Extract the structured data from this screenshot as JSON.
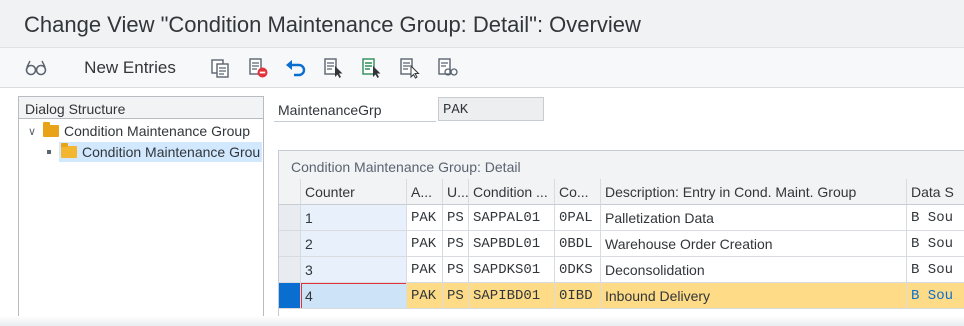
{
  "title": "Change View \"Condition Maintenance Group: Detail\": Overview",
  "toolbar": {
    "new_entries_label": "New Entries",
    "icons": [
      "glasses-icon",
      "copy-icon",
      "delete-icon",
      "undo-icon",
      "select-all-icon",
      "select-block-icon",
      "deselect-all-icon",
      "find-icon"
    ]
  },
  "dialog": {
    "header": "Dialog Structure",
    "items": [
      {
        "label": "Condition Maintenance Group",
        "level": 0,
        "expanded": true
      },
      {
        "label": "Condition Maintenance Grou",
        "level": 1,
        "selected": true
      }
    ]
  },
  "maintenance": {
    "label": "MaintenanceGrp",
    "value": "PAK"
  },
  "detail": {
    "title": "Condition Maintenance Group: Detail",
    "columns": [
      "Counter",
      "A...",
      "U...",
      "Condition ...",
      "Co...",
      "Description: Entry in Cond. Maint. Group",
      "Data S"
    ],
    "rows": [
      {
        "counter": "1",
        "a": "PAK",
        "u": "PS",
        "condition": "SAPPAL01",
        "co": "0PAL",
        "description": "Palletization Data",
        "data": "B Sou"
      },
      {
        "counter": "2",
        "a": "PAK",
        "u": "PS",
        "condition": "SAPBDL01",
        "co": "0BDL",
        "description": "Warehouse Order Creation",
        "data": "B Sou"
      },
      {
        "counter": "3",
        "a": "PAK",
        "u": "PS",
        "condition": "SAPDKS01",
        "co": "0DKS",
        "description": "Deconsolidation",
        "data": "B Sou"
      },
      {
        "counter": "4",
        "a": "PAK",
        "u": "PS",
        "condition": "SAPIBD01",
        "co": "0IBD",
        "description": "Inbound Delivery",
        "data": "B Sou"
      }
    ]
  },
  "colors": {
    "accent": "#0a6ed1",
    "highlight_row": "#fddb87",
    "folder": "#e8a317",
    "delete_red": "#e2333b"
  }
}
